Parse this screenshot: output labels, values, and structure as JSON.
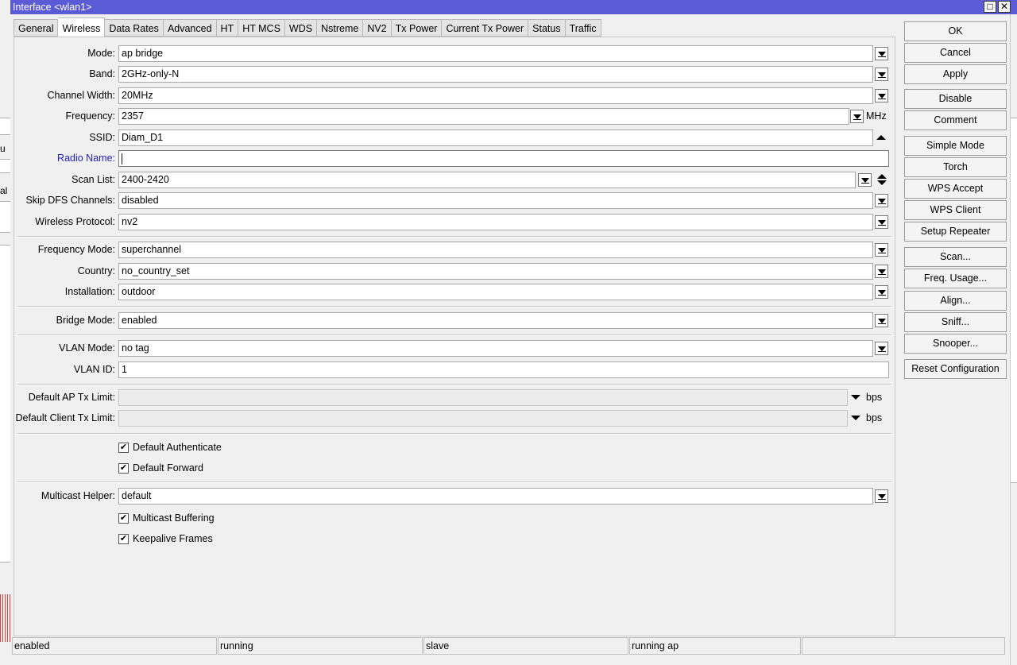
{
  "window": {
    "title": "Interface <wlan1>",
    "maximize_glyph": "□",
    "close_glyph": "✕"
  },
  "background": {
    "text_1": "u",
    "text_2": "al"
  },
  "tabs": [
    {
      "label": "General"
    },
    {
      "label": "Wireless",
      "active": true
    },
    {
      "label": "Data Rates"
    },
    {
      "label": "Advanced"
    },
    {
      "label": "HT"
    },
    {
      "label": "HT MCS"
    },
    {
      "label": "WDS"
    },
    {
      "label": "Nstreme"
    },
    {
      "label": "NV2"
    },
    {
      "label": "Tx Power"
    },
    {
      "label": "Current Tx Power"
    },
    {
      "label": "Status"
    },
    {
      "label": "Traffic"
    }
  ],
  "form": {
    "mode": {
      "label": "Mode:",
      "value": "ap bridge"
    },
    "band": {
      "label": "Band:",
      "value": "2GHz-only-N"
    },
    "channel_width": {
      "label": "Channel Width:",
      "value": "20MHz"
    },
    "frequency": {
      "label": "Frequency:",
      "value": "2357",
      "unit": "MHz"
    },
    "ssid": {
      "label": "SSID:",
      "value": "Diam_D1"
    },
    "radio_name": {
      "label": "Radio Name:",
      "value": ""
    },
    "scan_list": {
      "label": "Scan List:",
      "value": "2400-2420"
    },
    "skip_dfs": {
      "label": "Skip DFS Channels:",
      "value": "disabled"
    },
    "wireless_protocol": {
      "label": "Wireless Protocol:",
      "value": "nv2"
    },
    "frequency_mode": {
      "label": "Frequency Mode:",
      "value": "superchannel"
    },
    "country": {
      "label": "Country:",
      "value": "no_country_set"
    },
    "installation": {
      "label": "Installation:",
      "value": "outdoor"
    },
    "bridge_mode": {
      "label": "Bridge Mode:",
      "value": "enabled"
    },
    "vlan_mode": {
      "label": "VLAN Mode:",
      "value": "no tag"
    },
    "vlan_id": {
      "label": "VLAN ID:",
      "value": "1"
    },
    "default_ap_tx_limit": {
      "label": "Default AP Tx Limit:",
      "value": "",
      "unit": "bps"
    },
    "default_client_tx_limit": {
      "label": "Default Client Tx Limit:",
      "value": "",
      "unit": "bps"
    },
    "default_authenticate": {
      "label": "Default Authenticate",
      "checked": true
    },
    "default_forward": {
      "label": "Default Forward",
      "checked": true
    },
    "multicast_helper": {
      "label": "Multicast Helper:",
      "value": "default"
    },
    "multicast_buffering": {
      "label": "Multicast Buffering",
      "checked": true
    },
    "keepalive_frames": {
      "label": "Keepalive Frames",
      "checked": true
    },
    "check_glyph": "✔"
  },
  "buttons": {
    "ok": "OK",
    "cancel": "Cancel",
    "apply": "Apply",
    "disable": "Disable",
    "comment": "Comment",
    "simple_mode": "Simple Mode",
    "torch": "Torch",
    "wps_accept": "WPS Accept",
    "wps_client": "WPS Client",
    "setup_repeater": "Setup Repeater",
    "scan": "Scan...",
    "freq_usage": "Freq. Usage...",
    "align": "Align...",
    "sniff": "Sniff...",
    "snooper": "Snooper...",
    "reset_configuration": "Reset Configuration"
  },
  "status": {
    "enabled": "enabled",
    "running": "running",
    "slave": "slave",
    "running_ap": "running ap",
    "extra": ""
  }
}
